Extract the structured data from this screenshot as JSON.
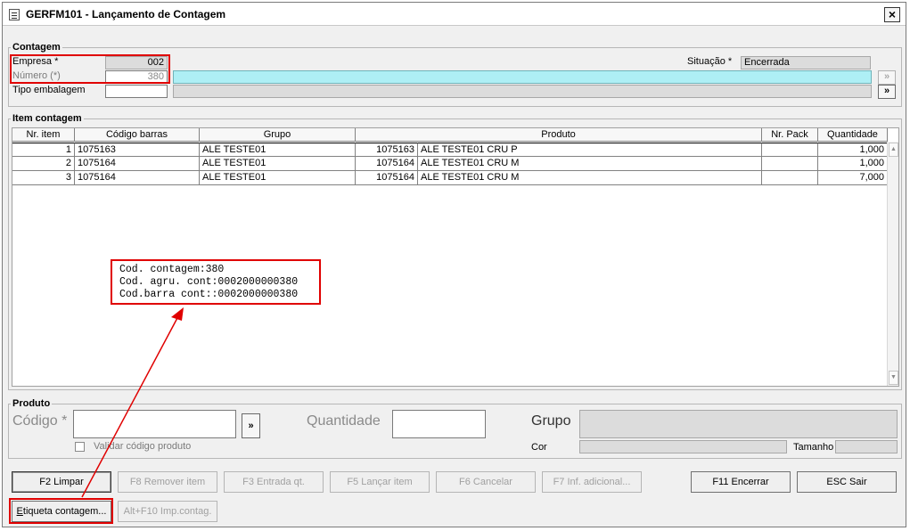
{
  "window": {
    "title": "GERFM101 - Lançamento de Contagem",
    "close_label": "×"
  },
  "contagem": {
    "legend": "Contagem",
    "empresa_label": "Empresa *",
    "empresa_value": "002",
    "numero_label": "Número (*)",
    "numero_value": "380",
    "numero_desc": "",
    "tipo_embalagem_label": "Tipo embalagem",
    "tipo_embalagem_value": "",
    "tipo_embalagem_desc": "",
    "situacao_label": "Situação *",
    "situacao_value": "Encerrada",
    "lookup_button_1": "»",
    "lookup_button_2": "»"
  },
  "item_contagem": {
    "legend": "Item contagem",
    "columns": [
      "Nr. item",
      "Código barras",
      "Grupo",
      "Produto",
      "Nr. Pack",
      "Quantidade"
    ],
    "rows": [
      {
        "nr_item": "1",
        "codigo_barras": "1075163",
        "grupo": "ALE TESTE01",
        "produto_cod": "1075163",
        "produto_desc": "ALE TESTE01 CRU P",
        "nr_pack": "",
        "quantidade": "1,000"
      },
      {
        "nr_item": "2",
        "codigo_barras": "1075164",
        "grupo": "ALE TESTE01",
        "produto_cod": "1075164",
        "produto_desc": "ALE TESTE01 CRU M",
        "nr_pack": "",
        "quantidade": "1,000"
      },
      {
        "nr_item": "3",
        "codigo_barras": "1075164",
        "grupo": "ALE TESTE01",
        "produto_cod": "1075164",
        "produto_desc": "ALE TESTE01 CRU M",
        "nr_pack": "",
        "quantidade": "7,000"
      }
    ]
  },
  "annotation": {
    "lines": [
      "Cod. contagem:380",
      "Cod. agru. cont:0002000000380",
      "Cod.barra cont::0002000000380"
    ]
  },
  "produto": {
    "legend": "Produto",
    "codigo_label": "Código *",
    "codigo_value": "",
    "lookup_button": "»",
    "quantidade_label": "Quantidade",
    "quantidade_value": "",
    "grupo_label": "Grupo",
    "grupo_value": "",
    "validar_label": "Validar código produto",
    "cor_label": "Cor",
    "cor_value": "",
    "tamanho_label": "Tamanho",
    "tamanho_value": ""
  },
  "buttons": {
    "limpar": "F2 Limpar",
    "remover": "F8 Remover item",
    "entrada": "F3 Entrada qt.",
    "lancar": "F5 Lançar item",
    "cancelar": "F6 Cancelar",
    "inf_adicional": "F7 Inf. adicional...",
    "encerrar": "F11 Encerrar",
    "sair": "ESC Sair",
    "etiqueta_u": "E",
    "etiqueta_rest": "tiqueta contagem...",
    "imp_contag": "Alt+F10 Imp.contag."
  },
  "colors": {
    "highlight_red": "#e00000",
    "input_cyan": "#aeeff5"
  }
}
